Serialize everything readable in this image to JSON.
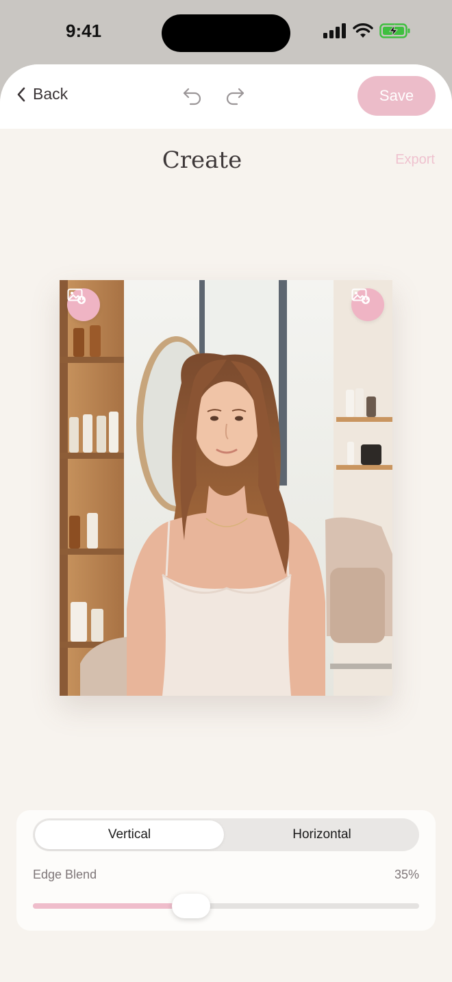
{
  "status_bar": {
    "time": "9:41"
  },
  "nav": {
    "back_label": "Back",
    "save_label": "Save"
  },
  "page": {
    "title": "Create",
    "export_label": "Export"
  },
  "controls": {
    "orientation_options": [
      "Vertical",
      "Horizontal"
    ],
    "selected_orientation": "Vertical",
    "edge_blend_label": "Edge Blend",
    "edge_blend_value": "35%",
    "edge_blend_fraction": 0.35
  },
  "colors": {
    "accent": "#efbdcb",
    "save_button": "#ecbcc9",
    "background": "#f7f3ee"
  }
}
